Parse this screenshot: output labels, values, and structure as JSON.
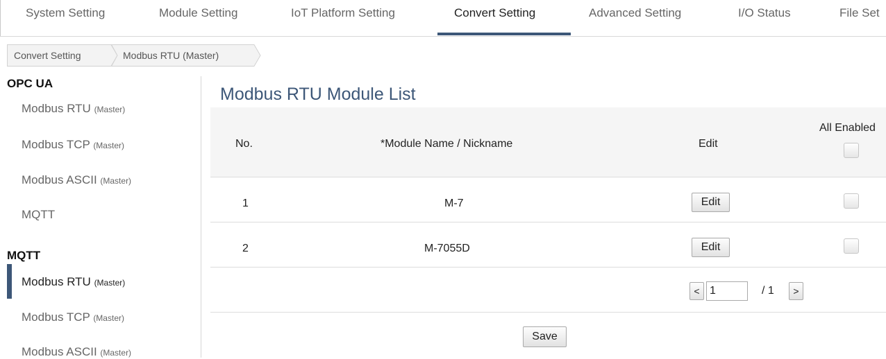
{
  "topnav": {
    "tabs": [
      {
        "label": "System Setting"
      },
      {
        "label": "Module Setting"
      },
      {
        "label": "IoT Platform Setting"
      },
      {
        "label": "Convert Setting"
      },
      {
        "label": "Advanced Setting"
      },
      {
        "label": "I/O Status"
      },
      {
        "label": "File Set"
      }
    ],
    "active_index": 3
  },
  "breadcrumb": [
    {
      "label": "Convert Setting"
    },
    {
      "label": "Modbus RTU (Master)"
    }
  ],
  "sidebar": {
    "groups": [
      {
        "title": "OPC UA",
        "items": [
          {
            "label": "Modbus RTU ",
            "sub": "(Master)"
          },
          {
            "label": "Modbus TCP ",
            "sub": "(Master)"
          },
          {
            "label": "Modbus ASCII ",
            "sub": "(Master)"
          },
          {
            "label": "MQTT",
            "sub": ""
          }
        ]
      },
      {
        "title": "MQTT",
        "items": [
          {
            "label": "Modbus RTU ",
            "sub": "(Master)",
            "active": true
          },
          {
            "label": "Modbus TCP ",
            "sub": "(Master)"
          },
          {
            "label": "Modbus ASCII ",
            "sub": "(Master)"
          }
        ]
      }
    ]
  },
  "main": {
    "title": "Modbus RTU Module List",
    "table": {
      "headers": {
        "no": "No.",
        "name": "*Module Name / Nickname",
        "edit": "Edit",
        "all_enabled": "All Enabled"
      },
      "rows": [
        {
          "no": "1",
          "name": "M-7",
          "edit_label": "Edit",
          "enabled": false
        },
        {
          "no": "2",
          "name": "M-7055D",
          "edit_label": "Edit",
          "enabled": false
        }
      ]
    },
    "pagination": {
      "prev": "<",
      "current": "1",
      "total": "/ 1",
      "next": ">"
    },
    "save_label": "Save"
  },
  "colors": {
    "accent": "#3d5778",
    "header_bg": "#f5f5f5"
  }
}
